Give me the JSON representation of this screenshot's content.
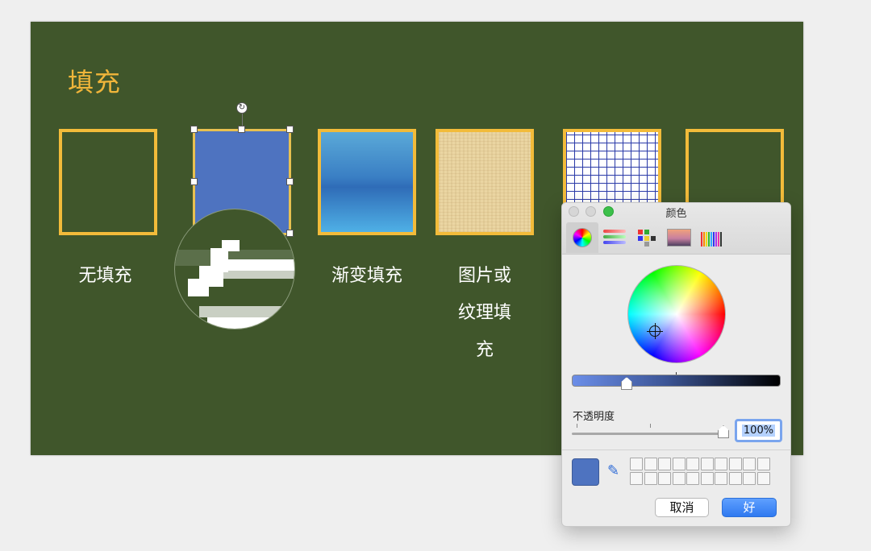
{
  "slide": {
    "title": "填充",
    "labels": {
      "no_fill": "无填充",
      "gradient_fill": "渐变填充",
      "picture_fill": "图片或",
      "picture_fill_2": "纹理填",
      "picture_fill_3": "充"
    }
  },
  "color_panel": {
    "title": "颜色",
    "tabs": [
      "color-wheel",
      "color-sliders",
      "color-palettes",
      "image-palettes",
      "pencils"
    ],
    "opacity_label": "不透明度",
    "opacity_value": "100%",
    "current_color": "#4e73c0",
    "buttons": {
      "cancel": "取消",
      "ok": "好"
    }
  },
  "colors": {
    "slide_bg": "#40562b",
    "accent_gold": "#f0b53a",
    "selected_fill": "#4e73c0",
    "ok_button": "#2f79f0"
  }
}
